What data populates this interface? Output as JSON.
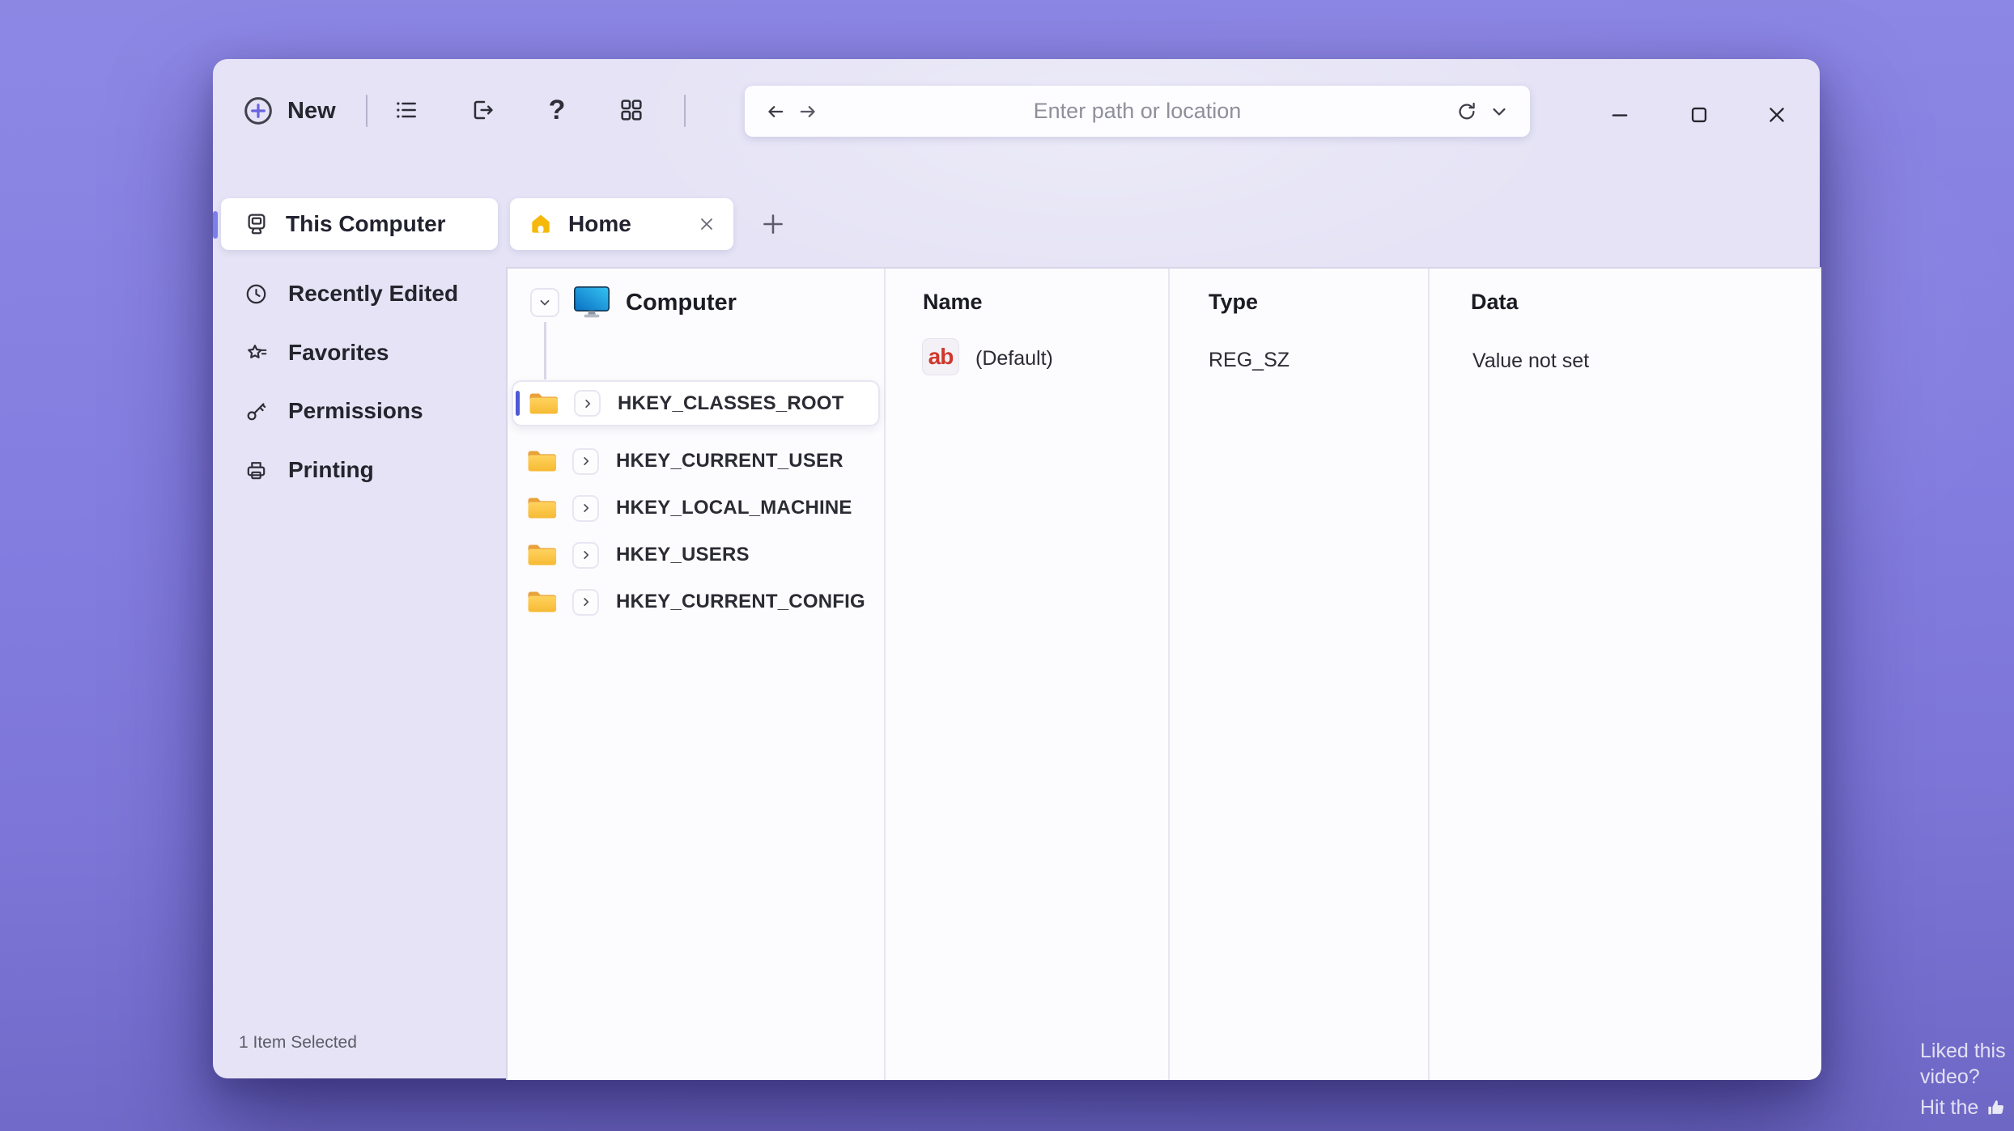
{
  "colors": {
    "accent": "#4f58d6",
    "accent_soft": "#7b80ea",
    "bg_top": "#8d87e4",
    "bg_bottom": "#6e67c4",
    "home_yellow": "#f5b80b",
    "reg_red": "#cf382c"
  },
  "toolbar": {
    "new_label": "New",
    "help_glyph": "?"
  },
  "address_bar": {
    "placeholder": "Enter path or location"
  },
  "tabs": {
    "pinned_label": "This Computer",
    "home_label": "Home"
  },
  "sidebar": {
    "items": [
      {
        "label": "Recently Edited",
        "icon": "clock-icon"
      },
      {
        "label": "Favorites",
        "icon": "star-icon"
      },
      {
        "label": "Permissions",
        "icon": "key-icon"
      },
      {
        "label": "Printing",
        "icon": "printer-icon"
      }
    ]
  },
  "tree": {
    "root_label": "Computer",
    "selected": "HKEY_CLASSES_ROOT",
    "items": [
      {
        "label": "HKEY_CLASSES_ROOT"
      },
      {
        "label": "HKEY_CURRENT_USER"
      },
      {
        "label": "HKEY_LOCAL_MACHINE"
      },
      {
        "label": "HKEY_USERS"
      },
      {
        "label": "HKEY_CURRENT_CONFIG"
      }
    ]
  },
  "columns": {
    "name": "Name",
    "type": "Type",
    "data": "Data"
  },
  "values": [
    {
      "icon_text": "ab",
      "name": "(Default)",
      "type": "REG_SZ",
      "data": "Value not set"
    }
  ],
  "status_bar": {
    "text": "1 Item Selected"
  },
  "overlay": {
    "line1": "Liked this",
    "line2": "video?",
    "line3": "Hit the"
  }
}
